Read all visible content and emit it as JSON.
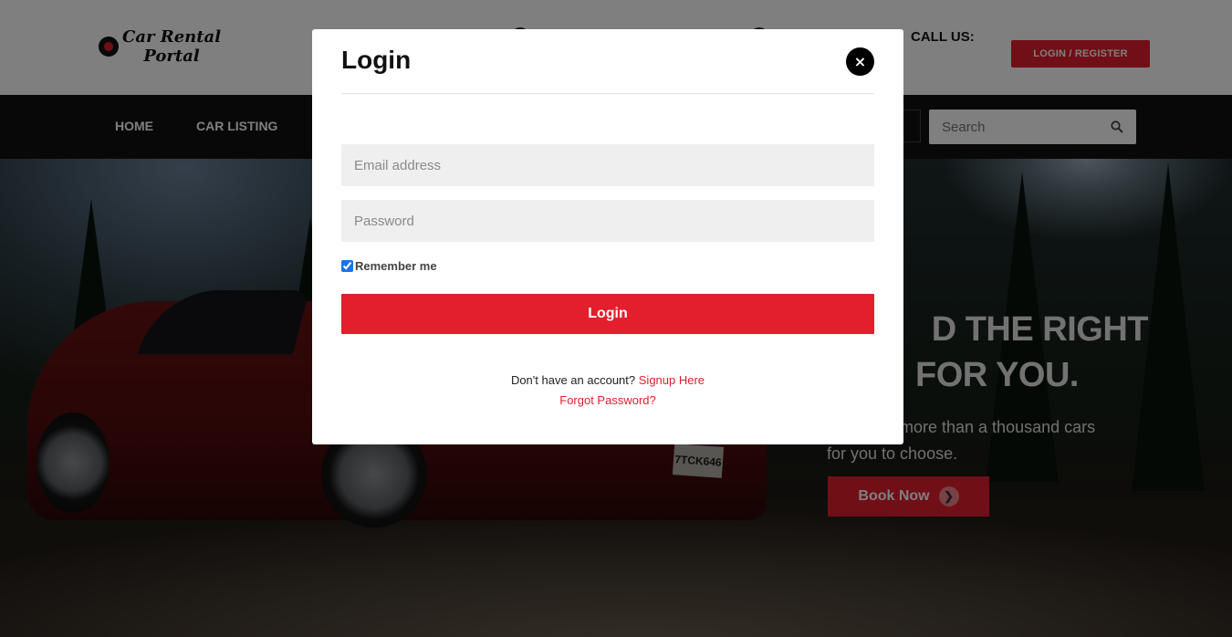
{
  "header": {
    "logo_text_line1": "Car Rental",
    "logo_text_line2": "Portal",
    "call_us_label": "CALL US:",
    "login_register_label": "LOGIN / REGISTER"
  },
  "nav": {
    "items": [
      {
        "label": "HOME"
      },
      {
        "label": "CAR LISTING"
      }
    ],
    "search_placeholder": "Search",
    "search_icon": "search-icon"
  },
  "hero": {
    "title_line1": "D THE RIGHT",
    "title_line2": "FOR YOU.",
    "subtitle_line1": "more than a thousand cars",
    "subtitle_line2": "for you to choose.",
    "book_now_label": "Book Now",
    "book_now_icon": "arrow-right-icon",
    "plate_text": "7TCK646"
  },
  "modal": {
    "title": "Login",
    "close_label": "×",
    "email_placeholder": "Email address",
    "password_placeholder": "Password",
    "remember_label": "Remember me",
    "remember_checked": true,
    "login_label": "Login",
    "no_account_text": "Don't have an account?",
    "signup_link": "Signup Here",
    "forgot_link": "Forgot Password?"
  },
  "colors": {
    "accent": "#e31e2d",
    "nav_bg": "#111111",
    "modal_bg": "#ffffff",
    "input_bg": "#efefef"
  }
}
